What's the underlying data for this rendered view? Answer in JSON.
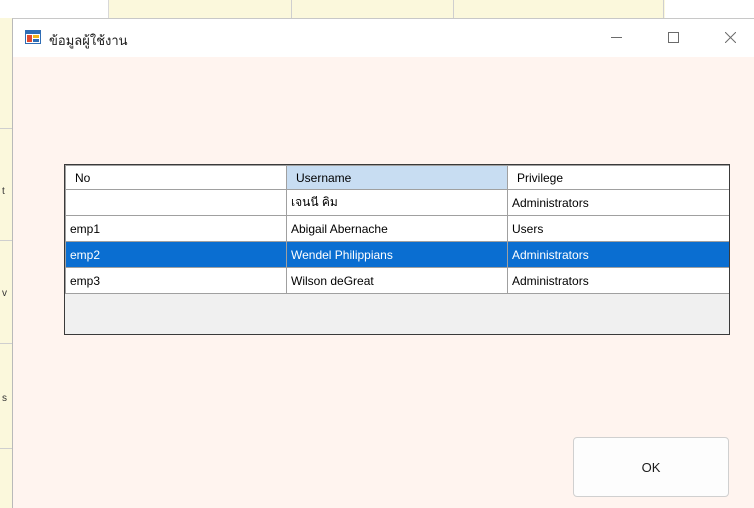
{
  "window": {
    "title": "ข้อมูลผู้ใช้งาน",
    "app_icon": "form-icon",
    "controls": {
      "minimize_icon": "minimize-icon",
      "maximize_icon": "maximize-icon",
      "close_icon": "close-icon"
    }
  },
  "grid": {
    "columns": [
      "No",
      "Username",
      "Privilege"
    ],
    "sorted_column": "Username",
    "rows": [
      {
        "no": "",
        "username": "เจนนี คิม",
        "privilege": "Administrators"
      },
      {
        "no": "emp1",
        "username": "Abigail Abernache",
        "privilege": "Users"
      },
      {
        "no": "emp2",
        "username": "Wendel Philippians",
        "privilege": "Administrators"
      },
      {
        "no": "emp3",
        "username": "Wilson deGreat",
        "privilege": "Administrators"
      }
    ],
    "selected_row": 2
  },
  "buttons": {
    "ok_label": "OK"
  },
  "colors": {
    "window_bg": "#fff4ef",
    "selection": "#0a6ed1",
    "header_highlight": "#c8ddf2"
  }
}
